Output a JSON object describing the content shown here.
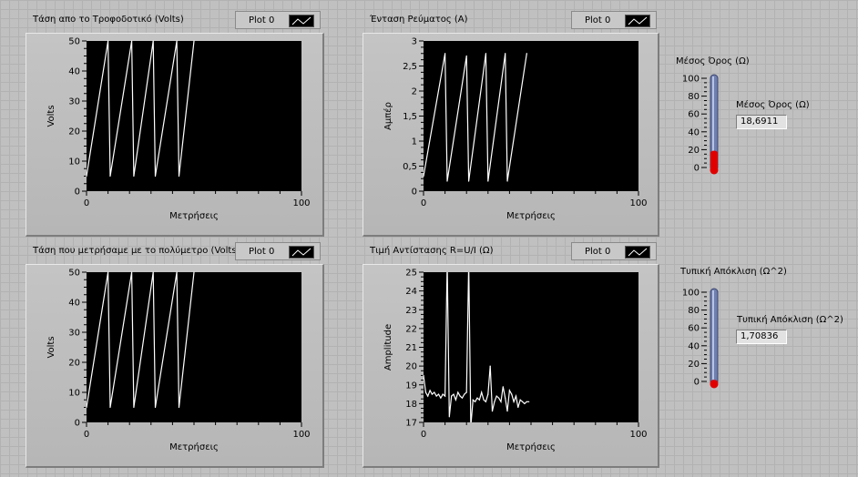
{
  "graphs": [
    {
      "title": "Τάση απο το Τροφοδοτικό (Volts)",
      "legend": "Plot 0",
      "chart_data": {
        "type": "line",
        "xlabel": "Μετρήσεις",
        "ylabel": "Volts",
        "xlim": [
          0,
          100
        ],
        "ylim": [
          0,
          50
        ],
        "y_ticks": [
          "0",
          "10",
          "20",
          "30",
          "40",
          "50"
        ],
        "x_ticks": [
          "0",
          "100"
        ],
        "series": [
          {
            "x": [
              0,
              10,
              11,
              21,
              22,
              31,
              32,
              42,
              43,
              50
            ],
            "y": [
              5,
              50,
              5,
              50,
              5,
              50,
              5,
              50,
              5,
              50
            ]
          }
        ]
      }
    },
    {
      "title": "Ένταση Ρεύματος (A)",
      "legend": "Plot 0",
      "chart_data": {
        "type": "line",
        "xlabel": "Μετρήσεις",
        "ylabel": "Αμπέρ",
        "xlim": [
          0,
          100
        ],
        "ylim": [
          0,
          3
        ],
        "y_ticks": [
          "0",
          "0,5",
          "1",
          "1,5",
          "2",
          "2,5",
          "3"
        ],
        "x_ticks": [
          "0",
          "100"
        ],
        "series": [
          {
            "x": [
              0,
              10,
              11,
              20,
              21,
              29,
              30,
              38,
              39,
              48
            ],
            "y": [
              0.3,
              2.75,
              0.2,
              2.7,
              0.2,
              2.75,
              0.2,
              2.75,
              0.2,
              2.75
            ]
          }
        ]
      }
    },
    {
      "title": "Τάση που μετρήσαμε με το πολύμετρο (Volts)",
      "legend": "Plot 0",
      "chart_data": {
        "type": "line",
        "xlabel": "Μετρήσεις",
        "ylabel": "Volts",
        "xlim": [
          0,
          100
        ],
        "ylim": [
          0,
          50
        ],
        "y_ticks": [
          "0",
          "10",
          "20",
          "30",
          "40",
          "50"
        ],
        "x_ticks": [
          "0",
          "100"
        ],
        "series": [
          {
            "x": [
              0,
              10,
              11,
              21,
              22,
              31,
              32,
              42,
              43,
              50
            ],
            "y": [
              5,
              50,
              5,
              50,
              5,
              50,
              5,
              50,
              5,
              50
            ]
          }
        ]
      }
    },
    {
      "title": "Τιμή Αντίστασης    R=U/I (Ω)",
      "legend": "Plot 0",
      "chart_data": {
        "type": "line",
        "xlabel": "Μετρήσεις",
        "ylabel": "Amplitude",
        "xlim": [
          0,
          100
        ],
        "ylim": [
          17,
          25
        ],
        "y_ticks": [
          "17",
          "18",
          "19",
          "20",
          "21",
          "22",
          "23",
          "24",
          "25"
        ],
        "x_ticks": [
          "0",
          "100"
        ],
        "series": [
          {
            "x": [
              0,
              1,
              2,
              3,
              4,
              5,
              6,
              7,
              8,
              9,
              10,
              11,
              12,
              13,
              14,
              15,
              16,
              17,
              18,
              19,
              20,
              21,
              22,
              23,
              24,
              25,
              26,
              27,
              28,
              29,
              30,
              31,
              32,
              33,
              34,
              35,
              36,
              37,
              38,
              39,
              40,
              41,
              42,
              43,
              44,
              45,
              46,
              47,
              48,
              49
            ],
            "y": [
              19.5,
              18.6,
              18.4,
              18.7,
              18.5,
              18.6,
              18.4,
              18.5,
              18.3,
              18.5,
              18.4,
              25.5,
              17.3,
              18.4,
              18.5,
              18.2,
              18.6,
              18.4,
              18.3,
              18.5,
              18.6,
              25.5,
              16.8,
              18.2,
              18.1,
              18.3,
              18.2,
              18.6,
              18.2,
              18.1,
              18.5,
              20.0,
              17.6,
              18.1,
              18.4,
              18.3,
              18.1,
              18.9,
              18.3,
              17.6,
              18.7,
              18.5,
              18.1,
              18.4,
              17.8,
              18.2,
              18.1,
              18.0,
              18.1,
              18.1
            ]
          }
        ]
      }
    }
  ],
  "indicators": [
    {
      "title": "Μέσος Όρος (Ω)",
      "value_label": "Μέσος Όρος (Ω)",
      "value": "18,6911",
      "scale": [
        "0",
        "20",
        "40",
        "60",
        "80",
        "100"
      ],
      "level": 18.6911,
      "max": 100
    },
    {
      "title": "Τυπική Απόκλιση (Ω^2)",
      "value_label": "Τυπική Απόκλιση (Ω^2)",
      "value": "1,70836",
      "scale": [
        "0",
        "20",
        "40",
        "60",
        "80",
        "100"
      ],
      "level": 1.70836,
      "max": 100
    }
  ],
  "colors": {
    "plot_bg": "#000000",
    "trace": "#ffffff",
    "mercury": "#e00000",
    "tube": "#6f7fae"
  }
}
